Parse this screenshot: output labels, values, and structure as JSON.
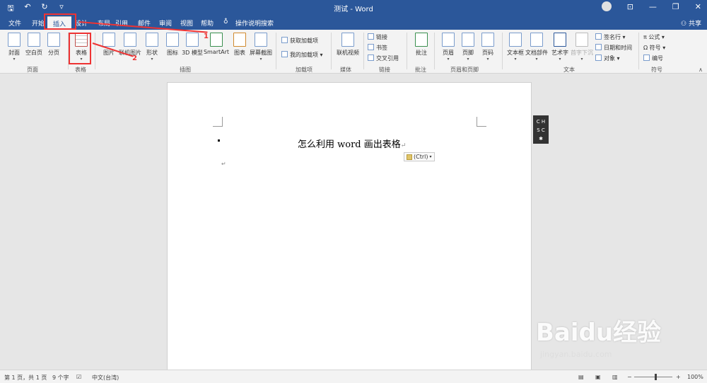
{
  "titlebar": {
    "title": "测试 - Word",
    "qat": [
      "save-icon",
      "undo-icon",
      "redo-icon",
      "customize-icon"
    ]
  },
  "tabs": [
    "文件",
    "开始",
    "插入",
    "设计",
    "布局",
    "引用",
    "邮件",
    "审阅",
    "视图",
    "帮助"
  ],
  "active_tab": "插入",
  "search": {
    "label": "操作说明搜索"
  },
  "share_label": "共享",
  "ribbon": {
    "pages": {
      "group": "页面",
      "cover": "封面",
      "blank": "空白页",
      "break": "分页"
    },
    "tables": {
      "group": "表格",
      "table": "表格"
    },
    "illustrations": {
      "group": "插图",
      "picture": "图片",
      "online_picture": "联机图片",
      "shapes": "形状",
      "icons": "图标",
      "model3d": "3D 模型",
      "smartart": "SmartArt",
      "chart": "图表",
      "screenshot": "屏幕截图"
    },
    "addins": {
      "group": "加载项",
      "get": "获取加载项",
      "my": "我的加载项"
    },
    "media": {
      "group": "媒体",
      "online_video": "联机视频"
    },
    "links": {
      "group": "链接",
      "link": "链接",
      "bookmark": "书签",
      "crossref": "交叉引用"
    },
    "comments": {
      "group": "批注",
      "comment": "批注"
    },
    "header_footer": {
      "group": "页眉和页脚",
      "header": "页眉",
      "footer": "页脚",
      "page_number": "页码"
    },
    "text": {
      "group": "文本",
      "textbox": "文本框",
      "quickparts": "文档部件",
      "wordart": "艺术字",
      "dropcap": "首字下沉",
      "signature": "签名行",
      "datetime": "日期和时间",
      "object": "对象"
    },
    "symbols": {
      "group": "符号",
      "equation": "公式",
      "symbol": "符号",
      "numbering": "编号"
    }
  },
  "document": {
    "heading": "怎么利用 word 画出表格",
    "paste_option": "(Ctrl)",
    "ime": [
      "C",
      "H",
      "S",
      "C"
    ]
  },
  "annotations": {
    "step1": "1",
    "step2": "2"
  },
  "statusbar": {
    "page": "第 1 页，共 1 页",
    "words": "9 个字",
    "language": "中文(台湾)",
    "zoom": "100%"
  },
  "watermark": {
    "brand": "Baidu经验",
    "url": "jingyan.baidu.com"
  },
  "colors": {
    "accent": "#2b579a",
    "annotation": "#ee3333"
  }
}
